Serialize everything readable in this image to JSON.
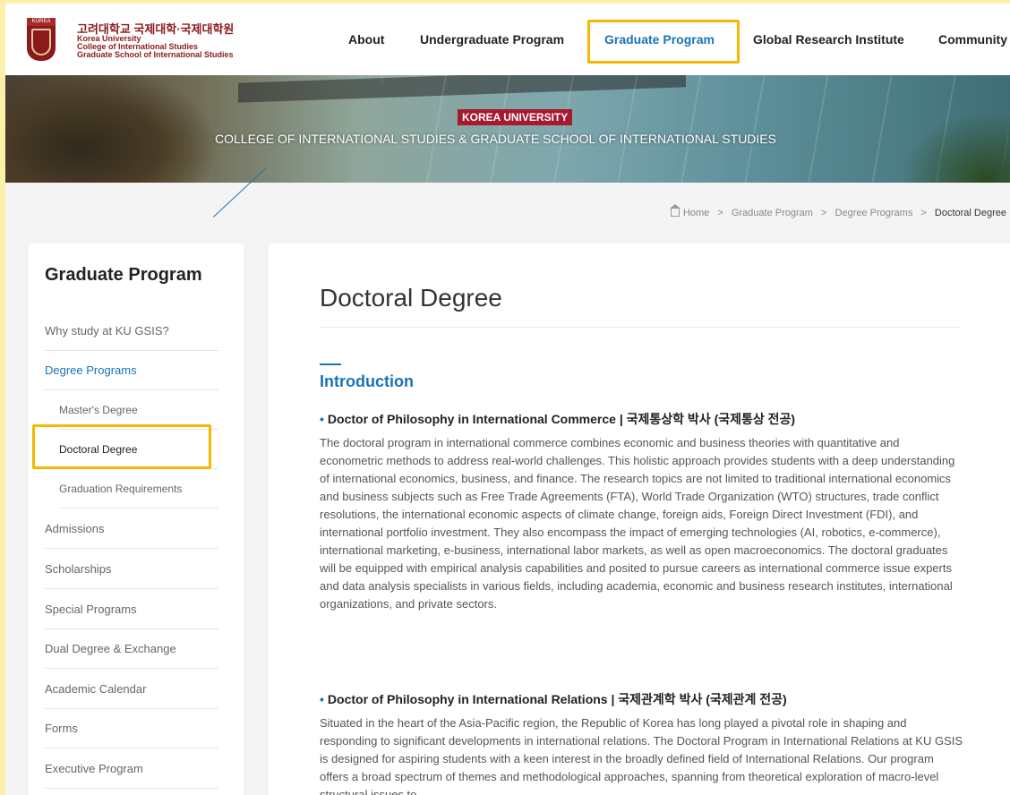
{
  "header": {
    "logo": {
      "emblem_text": "KOREA",
      "korean": "고려대학교 국제대학·국제대학원",
      "line1": "Korea University",
      "line2": "College of International Studies",
      "line3": "Graduate School of International Studies"
    },
    "nav": [
      {
        "label": "About"
      },
      {
        "label": "Undergraduate Program"
      },
      {
        "label": "Graduate Program",
        "active": true
      },
      {
        "label": "Global Research Institute"
      },
      {
        "label": "Community"
      }
    ]
  },
  "banner": {
    "label": "KOREA UNIVERSITY",
    "title": "COLLEGE OF INTERNATIONAL STUDIES & GRADUATE SCHOOL OF INTERNATIONAL STUDIES"
  },
  "breadcrumb": {
    "items": [
      "Home",
      "Graduate Program",
      "Degree Programs",
      "Doctoral Degree"
    ],
    "separator": ">"
  },
  "sidebar": {
    "title": "Graduate Program",
    "items": [
      {
        "label": "Why study at KU GSIS?"
      },
      {
        "label": "Degree Programs",
        "active": true
      },
      {
        "label": "Master's Degree",
        "sub": true
      },
      {
        "label": "Doctoral Degree",
        "sub": true,
        "current": true
      },
      {
        "label": "Graduation Requirements",
        "sub": true
      },
      {
        "label": "Admissions"
      },
      {
        "label": "Scholarships"
      },
      {
        "label": "Special Programs"
      },
      {
        "label": "Dual Degree & Exchange"
      },
      {
        "label": "Academic Calendar"
      },
      {
        "label": "Forms"
      },
      {
        "label": "Executive Program"
      }
    ]
  },
  "main": {
    "title": "Doctoral Degree",
    "intro": "Introduction",
    "sections": [
      {
        "heading": "Doctor of Philosophy in International Commerce | 국제통상학 박사 (국제통상 전공)",
        "body": "The doctoral program in international commerce combines economic and business theories with quantitative and econometric methods to address real-world challenges. This holistic approach provides students with a deep understanding of international economics, business, and finance. The research topics are not limited to traditional international economics and business subjects such as Free Trade Agreements (FTA), World Trade Organization (WTO) structures, trade conflict resolutions, the international economic aspects of climate change, foreign aids, Foreign Direct Investment (FDI), and international portfolio investment. They also encompass the impact of emerging technologies (AI, robotics, e-commerce), international marketing, e-business, international labor markets, as well as open macroeconomics. The doctoral graduates will be equipped with empirical analysis capabilities and posited to pursue careers as international commerce issue experts and data analysis specialists in various fields, including academia, economic and business research institutes, international organizations, and private sectors."
      },
      {
        "heading": "Doctor of Philosophy in International Relations | 국제관계학 박사 (국제관계 전공)",
        "body": "Situated in the heart of the Asia-Pacific region, the Republic of Korea has long played a pivotal role in shaping and responding to significant developments in international relations. The Doctoral Program in International Relations at KU GSIS is designed for aspiring students with a keen interest in the broadly defined field of International Relations. Our program offers a broad spectrum of themes and methodological approaches, spanning from theoretical exploration of macro-level structural issues to"
      }
    ]
  },
  "colors": {
    "accent": "#1a73b8",
    "brand": "#8b1a1a",
    "highlight": "#f5b800",
    "page_bg": "#fbf0a8"
  }
}
